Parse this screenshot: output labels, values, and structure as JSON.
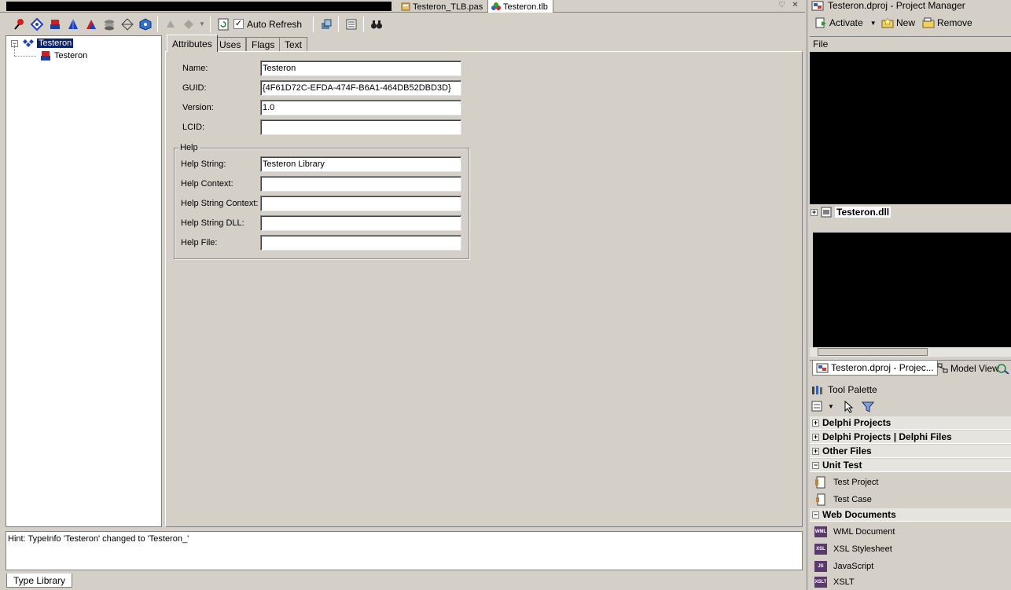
{
  "doc_tabs": [
    {
      "label": "Testeron_TLB.pas",
      "active": false
    },
    {
      "label": "Testeron.tlb",
      "active": true
    }
  ],
  "toolbar": {
    "auto_refresh_label": "Auto Refresh",
    "auto_refresh_checked": "✓"
  },
  "tree": {
    "root": "Testeron",
    "child": "Testeron"
  },
  "editor_tabs": [
    "Attributes",
    "Uses",
    "Flags",
    "Text"
  ],
  "attributes": {
    "name_label": "Name:",
    "name_value": "Testeron",
    "guid_label": "GUID:",
    "guid_value": "{4F61D72C-EFDA-474F-B6A1-464DB52DBD3D}",
    "version_label": "Version:",
    "version_value": "1.0",
    "lcid_label": "LCID:",
    "lcid_value": ""
  },
  "help": {
    "legend": "Help",
    "string_label": "Help String:",
    "string_value": "Testeron Library",
    "context_label": "Help Context:",
    "context_value": "",
    "string_context_label": "Help String Context:",
    "string_context_value": "",
    "string_dll_label": "Help String DLL:",
    "string_dll_value": "",
    "file_label": "Help File:",
    "file_value": ""
  },
  "hint": "Hint: TypeInfo 'Testeron' changed to 'Testeron_'",
  "bottom_tab": "Type Library",
  "project_manager": {
    "title": "Testeron.dproj - Project Manager",
    "activate": "Activate",
    "new": "New",
    "remove": "Remove",
    "column": "File",
    "node": "Testeron.dll",
    "tab1": "Testeron.dproj - Projec...",
    "tab2": "Model View"
  },
  "tool_palette": {
    "title": "Tool Palette",
    "categories": [
      "Delphi Projects",
      "Delphi Projects | Delphi Files",
      "Other Files",
      "Unit Test",
      "Web Documents"
    ],
    "unit_test_items": [
      "Test Project",
      "Test Case"
    ],
    "web_items": [
      {
        "label": "WML Document",
        "icon": "WML"
      },
      {
        "label": "XSL Stylesheet",
        "icon": "XSL"
      },
      {
        "label": "JavaScript",
        "icon": "JS"
      },
      {
        "label": "XSLT",
        "icon": "XSLT"
      }
    ]
  }
}
